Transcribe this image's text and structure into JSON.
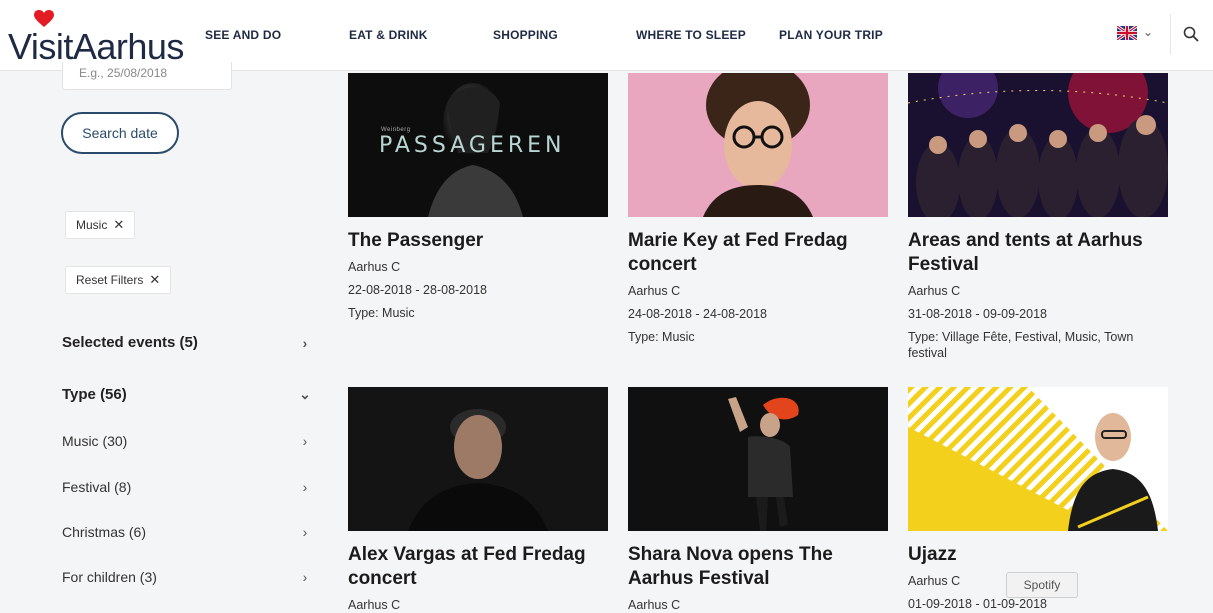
{
  "header": {
    "logo_text": "VisitAarhus",
    "nav": [
      "SEE AND DO",
      "EAT & DRINK",
      "SHOPPING",
      "WHERE TO SLEEP",
      "PLAN YOUR TRIP"
    ],
    "language_icon": "uk-flag-icon",
    "search_icon": "search-icon"
  },
  "sidebar": {
    "date_input_value": "E.g., 25/08/2018",
    "search_date_label": "Search date",
    "chips": {
      "music": "Music",
      "reset": "Reset Filters"
    },
    "filters": {
      "selected_events": "Selected events (5)",
      "type": "Type (56)",
      "music": "Music (30)",
      "festival": "Festival (8)",
      "christmas": "Christmas (6)",
      "for_children": "For children (3)"
    }
  },
  "events": [
    {
      "title": "The Passenger",
      "location": "Aarhus C",
      "dates": "22-08-2018 - 28-08-2018",
      "type": "Type: Music",
      "image_text": "PASSAGEREN",
      "image_subtext": "Weinberg"
    },
    {
      "title": "Marie Key at Fed Fredag concert",
      "location": "Aarhus C",
      "dates": "24-08-2018 - 24-08-2018",
      "type": "Type: Music"
    },
    {
      "title": "Areas and tents at Aarhus Festival",
      "location": "Aarhus C",
      "dates": "31-08-2018 - 09-09-2018",
      "type": "Type: Village Fête, Festival, Music, Town festival"
    },
    {
      "title": "Alex Vargas at Fed Fredag concert",
      "location": "Aarhus C"
    },
    {
      "title": "Shara Nova opens The Aarhus Festival",
      "location": "Aarhus C"
    },
    {
      "title": "Ujazz",
      "location": "Aarhus C",
      "dates": "01-09-2018 - 01-09-2018"
    }
  ],
  "spotify_label": "Spotify",
  "colors": {
    "brand_red": "#e31b23",
    "navy": "#1e2a44",
    "button_border": "#2b4a6b"
  }
}
